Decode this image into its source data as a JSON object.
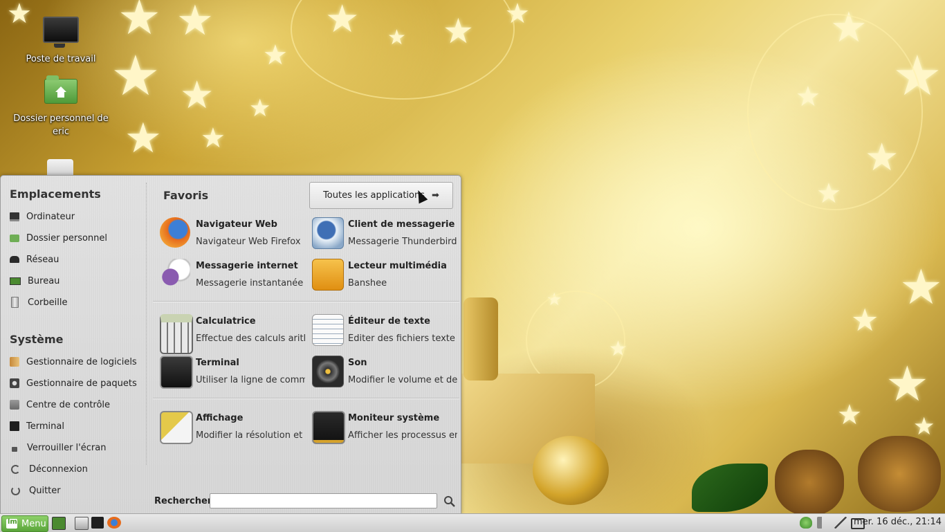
{
  "desktop": {
    "icons": [
      {
        "label": "Poste de travail",
        "icon": "computer-icon"
      },
      {
        "label": "Dossier personnel de eric",
        "icon": "home-folder-icon"
      }
    ]
  },
  "menu": {
    "places": {
      "title": "Emplacements",
      "items": [
        {
          "label": "Ordinateur",
          "icon": "computer-icon"
        },
        {
          "label": "Dossier personnel",
          "icon": "home-folder-icon"
        },
        {
          "label": "Réseau",
          "icon": "network-icon"
        },
        {
          "label": "Bureau",
          "icon": "desktop-icon"
        },
        {
          "label": "Corbeille",
          "icon": "trash-icon"
        }
      ]
    },
    "system": {
      "title": "Système",
      "items": [
        {
          "label": "Gestionnaire de logiciels",
          "icon": "software-manager-icon"
        },
        {
          "label": "Gestionnaire de paquets",
          "icon": "package-manager-icon"
        },
        {
          "label": "Centre de contrôle",
          "icon": "control-center-icon"
        },
        {
          "label": "Terminal",
          "icon": "terminal-icon"
        },
        {
          "label": "Verrouiller l'écran",
          "icon": "lock-icon"
        },
        {
          "label": "Déconnexion",
          "icon": "logout-icon"
        },
        {
          "label": "Quitter",
          "icon": "power-icon"
        }
      ]
    },
    "favorites_title": "Favoris",
    "all_apps_label": "Toutes les applications",
    "favorites": [
      {
        "name": "Navigateur Web",
        "desc": "Navigateur Web Firefox",
        "icon": "firefox-icon"
      },
      {
        "name": "Client de messagerie",
        "desc": "Messagerie Thunderbird",
        "icon": "thunderbird-icon"
      },
      {
        "name": "Messagerie internet",
        "desc": "Messagerie instantanée ...",
        "icon": "pidgin-icon"
      },
      {
        "name": "Lecteur multimédia",
        "desc": "Banshee",
        "icon": "banshee-icon"
      },
      {
        "name": "Calculatrice",
        "desc": "Effectue des calculs arith...",
        "icon": "calculator-icon"
      },
      {
        "name": "Éditeur de texte",
        "desc": "Éditer des fichiers texte",
        "icon": "text-editor-icon"
      },
      {
        "name": "Terminal",
        "desc": "Utiliser la ligne de comm...",
        "icon": "terminal-icon"
      },
      {
        "name": "Son",
        "desc": "Modifier le volume et des...",
        "icon": "sound-icon"
      },
      {
        "name": "Affichage",
        "desc": "Modifier la résolution et l...",
        "icon": "display-icon"
      },
      {
        "name": "Moniteur système",
        "desc": "Afficher les processus en...",
        "icon": "system-monitor-icon"
      }
    ],
    "search_label": "Rechercher :",
    "search_value": ""
  },
  "taskbar": {
    "menu_label": "Menu",
    "clock": "mer. 16 déc., 21:14"
  }
}
